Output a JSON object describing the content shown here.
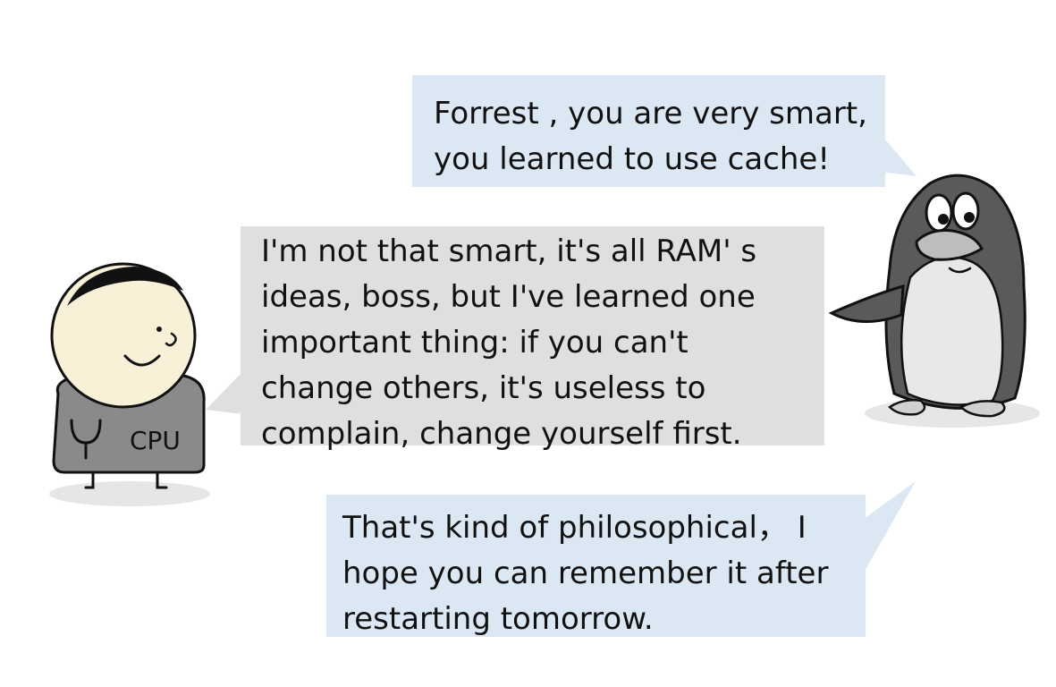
{
  "bubbles": {
    "penguin_top": {
      "lines": [
        "Forrest , you are very smart,",
        "you learned  to use cache!"
      ]
    },
    "cpu_reply": {
      "lines": [
        "I'm not that smart, it's all RAM' s",
        "ideas, boss, but I've learned one",
        "important thing: if you can't",
        "change others, it's useless to",
        "complain, change yourself first."
      ]
    },
    "penguin_bottom": {
      "lines": [
        "That's kind of philosophical， I",
        "hope you can remember it after",
        "restarting tomorrow."
      ]
    }
  },
  "characters": {
    "cpu": {
      "shirt_text": "CPU",
      "icon": "cpu-character"
    },
    "penguin": {
      "icon": "penguin-character"
    }
  },
  "colors": {
    "penguin_bubble": "#dbe8f4",
    "cpu_bubble": "#dfdfdf",
    "cpu_shirt": "#8a8a8a",
    "penguin_body": "#5a5a5a"
  }
}
